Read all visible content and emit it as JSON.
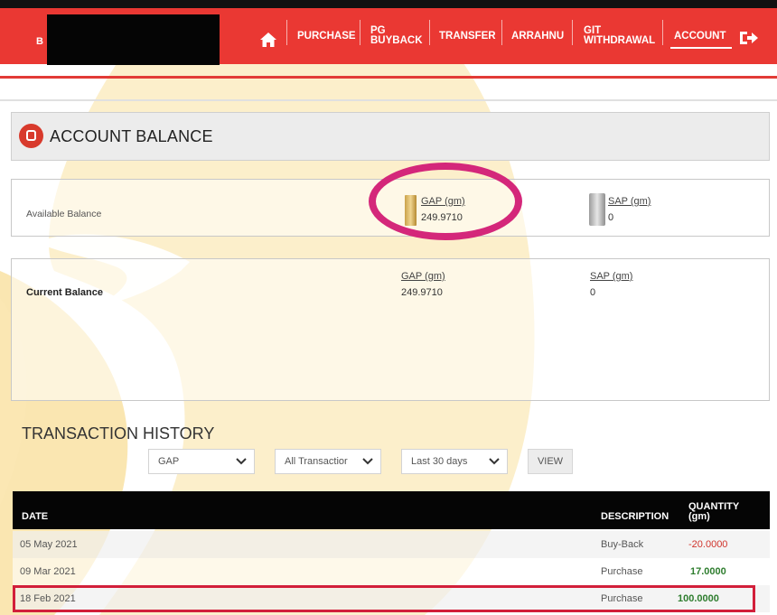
{
  "nav": {
    "items": [
      {
        "label": "PURCHASE"
      },
      {
        "label": "PG",
        "label2": "BUYBACK"
      },
      {
        "label": "TRANSFER"
      },
      {
        "label": "ARRAHNU"
      },
      {
        "label": "GIT",
        "label2": "WITHDRAWAL"
      },
      {
        "label": "ACCOUNT"
      }
    ],
    "active": "ACCOUNT",
    "home_icon": "home-icon",
    "logout_icon": "logout-icon"
  },
  "page_title": "ACCOUNT BALANCE",
  "available": {
    "label": "Available Balance",
    "gap_label": "GAP (gm)",
    "gap_value": "249.9710",
    "sap_label": "SAP (gm)",
    "sap_value": "0"
  },
  "current": {
    "label": "Current Balance",
    "gap_label": "GAP (gm)",
    "gap_value": "249.9710",
    "sap_label": "SAP (gm)",
    "sap_value": "0"
  },
  "history": {
    "title": "TRANSACTION HISTORY",
    "filters": {
      "product": "GAP",
      "type": "All Transactior",
      "period": "Last 30 days",
      "view_label": "VIEW"
    },
    "columns": {
      "date": "DATE",
      "description": "DESCRIPTION",
      "quantity": "QUANTITY",
      "quantity_unit": "(gm)"
    },
    "rows": [
      {
        "date": "05 May 2021",
        "description": "Buy-Back",
        "quantity": "-20.0000"
      },
      {
        "date": "09 Mar 2021",
        "description": "Purchase",
        "quantity": "17.0000"
      },
      {
        "date": "18 Feb 2021",
        "description": "Purchase",
        "quantity": "100.0000"
      }
    ]
  },
  "colors": {
    "brand_red": "#ea3833",
    "highlight_magenta": "#d4277a",
    "negative": "#d0342c",
    "positive": "#2e7d2e"
  }
}
